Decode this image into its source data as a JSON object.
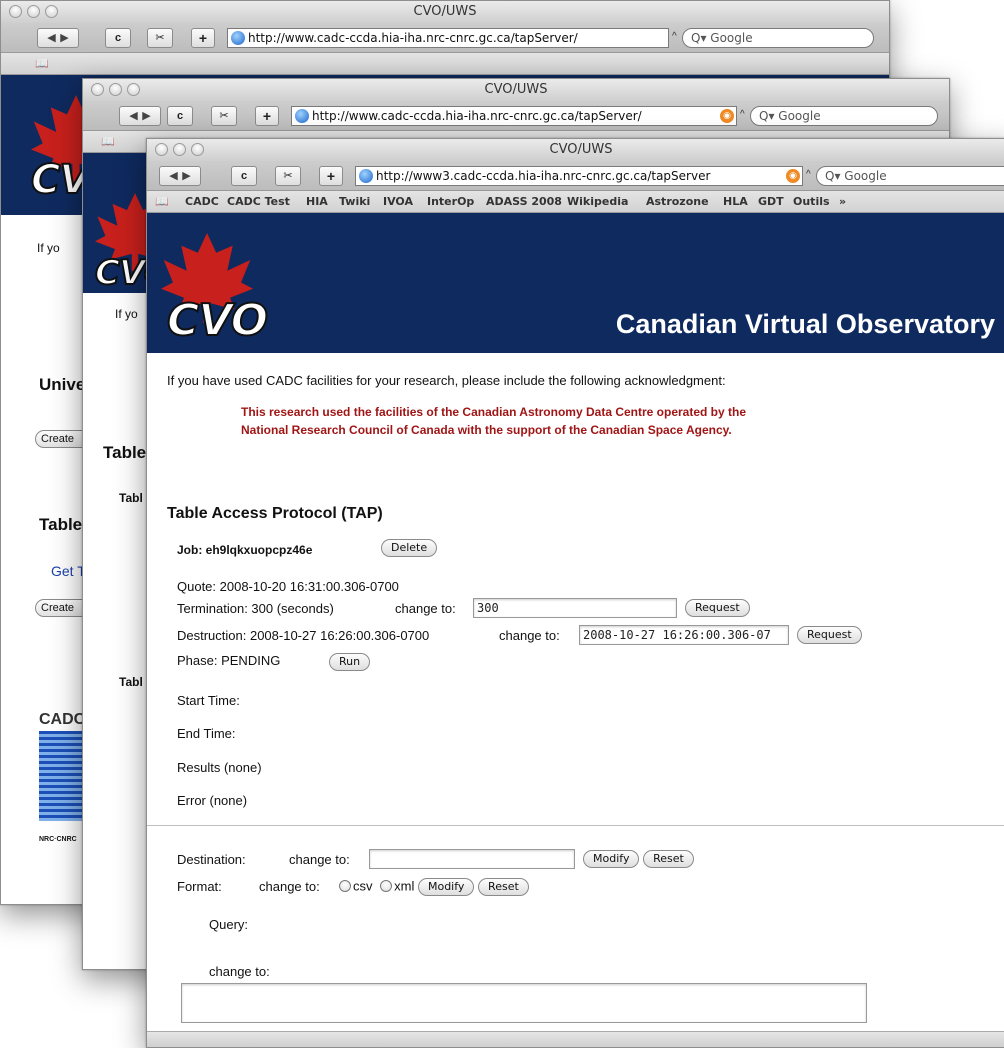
{
  "browser": {
    "window_title": "CVO/UWS",
    "back_glyph": "◀",
    "forward_glyph": "▶",
    "reload_glyph": "c",
    "snip_glyph": "✂",
    "add_glyph": "+",
    "search_placeholder": "Q▾ Google",
    "bookmarks_glyph": "📖",
    "url_back": "http://www.cadc-ccda.hia-iha.nrc-cnrc.gc.ca/tapServer/",
    "url_middle": "http://www.cadc-ccda.hia-iha.nrc-cnrc.gc.ca/tapServer/",
    "url_front": "http://www3.cadc-ccda.hia-iha.nrc-cnrc.gc.ca/tapServer",
    "bookmarks": [
      "CADC",
      "CADC Test",
      "HIA",
      "Twiki",
      "IVOA",
      "InterOp",
      "ADASS 2008",
      "Wikipedia",
      "Astrozone",
      "HLA",
      "GDT",
      "Outils",
      "»"
    ],
    "icons": [
      "globe-icon",
      "rss-icon",
      "bookmarks-book-icon",
      "snapback-icon"
    ]
  },
  "brand": {
    "logo_text": "CVO",
    "site_title": "Canadian Virtual Observatory",
    "colors": {
      "banner": "#0f2a5f",
      "leaf": "#c8201c",
      "ack": "#a01515"
    }
  },
  "back_window": {
    "intro": "If yo",
    "heading1": "Unive",
    "button1": "Create",
    "heading2": "Table",
    "link": "Get T",
    "button2": "Create",
    "logo_text": "CADC",
    "footer_text": "NRC·CNRC"
  },
  "middle_window": {
    "intro": "If yo",
    "heading": "Table",
    "sub1": "Tabl",
    "sub2": "Tabl"
  },
  "page": {
    "ack_intro": "If you have used CADC facilities for your research, please include the following acknowledgment:",
    "ack_line1": "This research used the facilities of the Canadian Astronomy Data Centre operated by the",
    "ack_line2": "National Research Council of Canada with the support of the Canadian Space Agency.",
    "heading": "Table Access Protocol (TAP)",
    "job_label": "Job: eh9lqkxuopcpz46e",
    "delete_button": "Delete",
    "quote": "Quote: 2008-10-20 16:31:00.306-0700",
    "termination": "Termination: 300 (seconds)",
    "change_to": "change to:",
    "termination_value": "300",
    "request_button": "Request",
    "destruction": "Destruction: 2008-10-27 16:26:00.306-0700",
    "destruction_value": "2008-10-27 16:26:00.306-07",
    "phase": "Phase: PENDING",
    "run_button": "Run",
    "start_time": "Start Time:",
    "end_time": "End Time:",
    "results": "Results (none)",
    "error": "Error (none)",
    "destination_label": "Destination:",
    "destination_value": "",
    "modify_button": "Modify",
    "reset_button": "Reset",
    "format_label": "Format:",
    "format_options": [
      "csv",
      "xml"
    ],
    "query_label": "Query:",
    "query_value": ""
  }
}
